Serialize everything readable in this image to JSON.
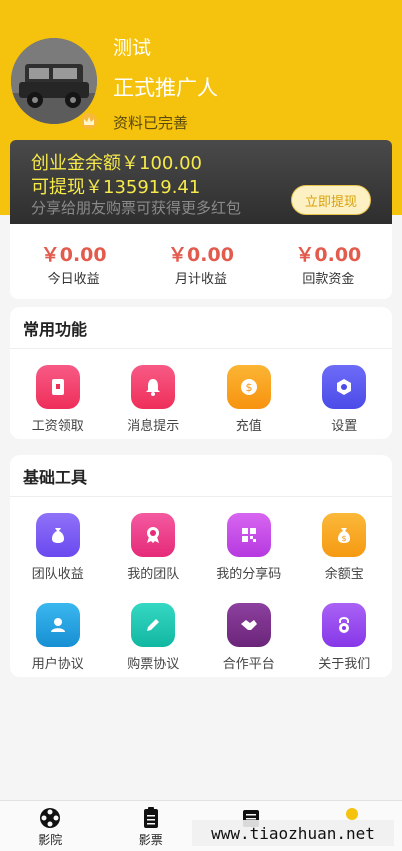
{
  "header": {
    "name": "测试",
    "role": "正式推广人",
    "status": "资料已完善",
    "crown_icon": "crown-icon"
  },
  "balance": {
    "startup_balance": "创业金余额￥100.00",
    "withdrawable": "可提现￥135919.41",
    "hint": "分享给朋友购票可获得更多红包",
    "withdraw_label": "立即提现"
  },
  "stats": [
    {
      "value": "￥0.00",
      "label": "今日收益"
    },
    {
      "value": "￥0.00",
      "label": "月计收益"
    },
    {
      "value": "￥0.00",
      "label": "回款资金"
    }
  ],
  "common": {
    "title": "常用功能",
    "items": [
      {
        "label": "工资领取",
        "icon": "wallet-icon",
        "color": "#f0436a"
      },
      {
        "label": "消息提示",
        "icon": "bell-icon",
        "color": "#f0436a"
      },
      {
        "label": "充值",
        "icon": "coin-icon",
        "color": "#f9a11b"
      },
      {
        "label": "设置",
        "icon": "gear-icon",
        "color": "#5b5bf2"
      }
    ]
  },
  "tools": {
    "title": "基础工具",
    "items": [
      {
        "label": "团队收益",
        "icon": "money-bag-icon",
        "color": "#7b5cf5"
      },
      {
        "label": "我的团队",
        "icon": "badge-icon",
        "color": "#ef3e8d"
      },
      {
        "label": "我的分享码",
        "icon": "qrcode-icon",
        "color": "#c94ce8"
      },
      {
        "label": "余额宝",
        "icon": "money-bag-icon",
        "color": "#f9a825"
      },
      {
        "label": "用户协议",
        "icon": "user-icon",
        "color": "#22a4e3"
      },
      {
        "label": "购票协议",
        "icon": "pencil-icon",
        "color": "#1fc8b4"
      },
      {
        "label": "合作平台",
        "icon": "handshake-icon",
        "color": "#7a2f8e"
      },
      {
        "label": "关于我们",
        "icon": "lock-icon",
        "color": "#9a4df0"
      }
    ]
  },
  "tabbar": [
    {
      "label": "影院",
      "icon": "film-reel-icon"
    },
    {
      "label": "影票",
      "icon": "ticket-icon"
    },
    {
      "label": "",
      "icon": "list-icon"
    },
    {
      "label": "",
      "icon": "user-icon"
    }
  ],
  "watermark": "www.tiaozhuan.net"
}
